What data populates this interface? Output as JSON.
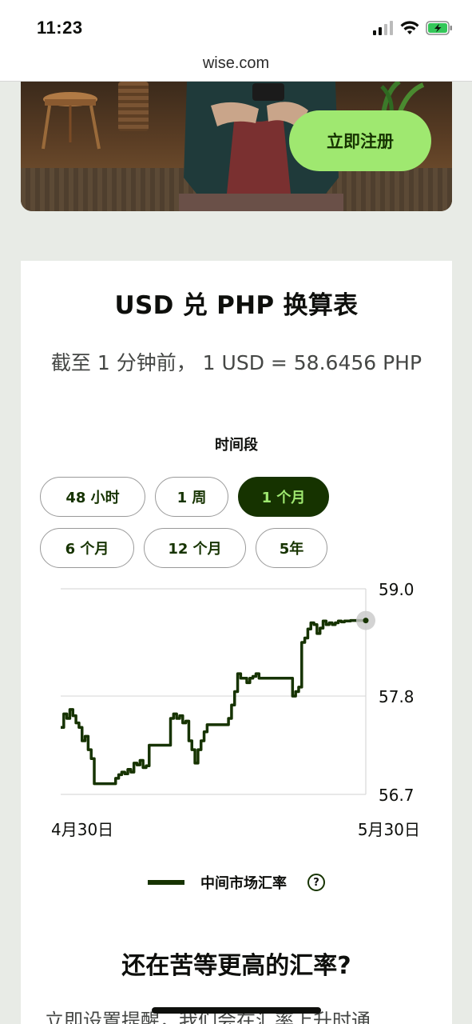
{
  "status_bar": {
    "time": "11:23"
  },
  "browser": {
    "url": "wise.com"
  },
  "hero": {
    "signup_label": "立即注册"
  },
  "converter": {
    "title": "USD 兑 PHP 换算表",
    "rate_text": "截至 1 分钟前， 1 USD = 58.6456 PHP",
    "period_label": "时间段",
    "periods": [
      "48 小时",
      "1 周",
      "1 个月",
      "6 个月",
      "12 个月",
      "5年"
    ],
    "active_period": "1 个月"
  },
  "chart_data": {
    "type": "line",
    "ytick_labels": [
      "59.0",
      "57.8",
      "56.7"
    ],
    "ylim": [
      56.7,
      59.0
    ],
    "xtick_labels": [
      "4月30日",
      "5月30日"
    ],
    "grid": true,
    "legend_position": "bottom",
    "series": [
      {
        "name": "中间市场汇率",
        "color": "#163300",
        "x": [
          0,
          1,
          2,
          3,
          4,
          5,
          6,
          7,
          8,
          9,
          10,
          11,
          12,
          13,
          14,
          15,
          16,
          17,
          18,
          19,
          20,
          21,
          22,
          23,
          24,
          25,
          26,
          27,
          28,
          29,
          30,
          31,
          32,
          33,
          34,
          35,
          36,
          37,
          38,
          39,
          40,
          41,
          42,
          43,
          44,
          45,
          46,
          47,
          48,
          49,
          50,
          51,
          52,
          53,
          54,
          55,
          56,
          57,
          58,
          59,
          60,
          61,
          62,
          63,
          64,
          65,
          66,
          67,
          68,
          69,
          70,
          71,
          72,
          73,
          74,
          75,
          76,
          77,
          78,
          79,
          80,
          81,
          82,
          83,
          84,
          85,
          86,
          87,
          88,
          89,
          90,
          91,
          92,
          93,
          94,
          95,
          96,
          97,
          98,
          99,
          100
        ],
        "y": [
          57.45,
          57.6,
          57.55,
          57.65,
          57.58,
          57.5,
          57.45,
          57.3,
          57.35,
          57.2,
          57.1,
          56.82,
          56.82,
          56.82,
          56.82,
          56.82,
          56.82,
          56.82,
          56.88,
          56.92,
          56.95,
          56.93,
          56.98,
          56.95,
          57.05,
          57.03,
          57.08,
          57.0,
          57.02,
          57.25,
          57.25,
          57.25,
          57.25,
          57.25,
          57.25,
          57.25,
          57.55,
          57.6,
          57.55,
          57.58,
          57.5,
          57.52,
          57.3,
          57.2,
          57.05,
          57.2,
          57.3,
          57.4,
          57.48,
          57.48,
          57.48,
          57.48,
          57.48,
          57.48,
          57.48,
          57.55,
          57.7,
          57.85,
          58.05,
          58.0,
          58.0,
          57.95,
          58.0,
          58.02,
          58.05,
          58.0,
          58.0,
          58.0,
          58.0,
          58.0,
          58.0,
          58.0,
          58.0,
          58.0,
          58.0,
          58.0,
          57.8,
          57.85,
          57.9,
          58.4,
          58.45,
          58.55,
          58.62,
          58.6,
          58.5,
          58.56,
          58.64,
          58.6,
          58.62,
          58.6,
          58.62,
          58.64,
          58.63,
          58.64,
          58.64,
          58.645,
          58.645,
          58.645,
          58.645,
          58.645,
          58.6456
        ]
      }
    ]
  },
  "section2": {
    "title": "还在苦等更高的汇率?",
    "body": "立即设置提醒，我们会在汇率上升时通"
  },
  "colors": {
    "accent": "#9fe870",
    "forest": "#163300",
    "page_bg": "#e8ebe6"
  }
}
